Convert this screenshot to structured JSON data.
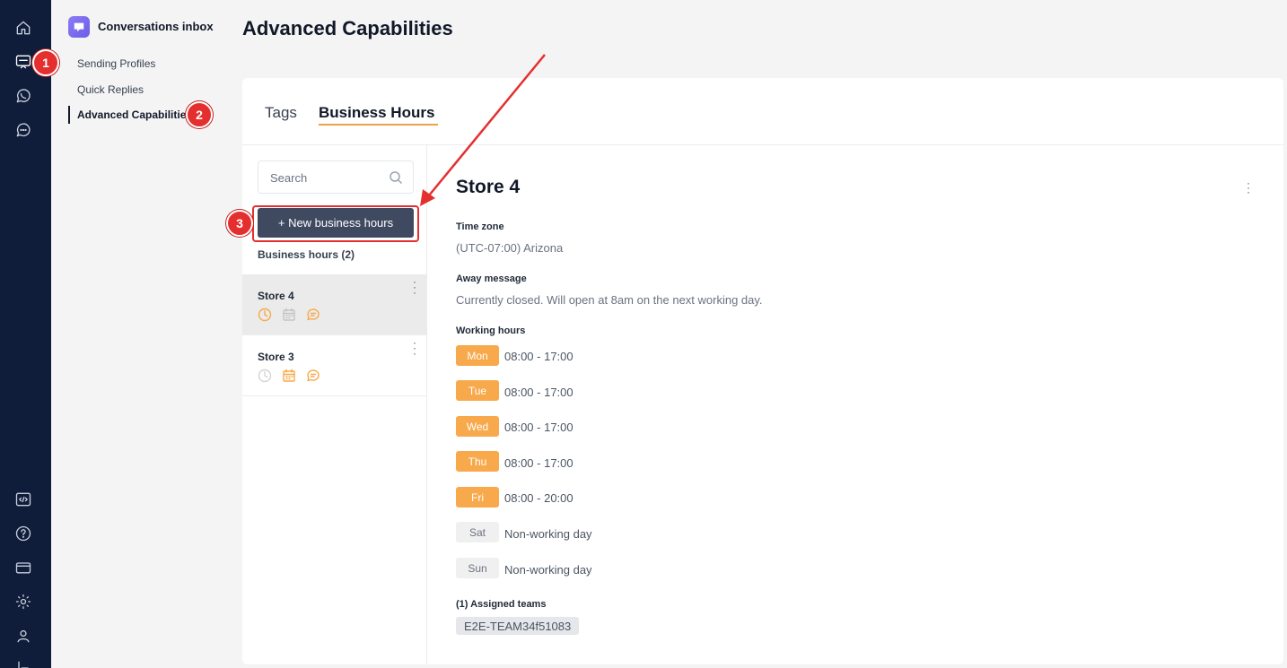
{
  "subnav": {
    "title": "Conversations inbox",
    "items": [
      {
        "label": "Sending Profiles"
      },
      {
        "label": "Quick Replies"
      },
      {
        "label": "Advanced Capabilities"
      }
    ]
  },
  "annotations": {
    "one": "1",
    "two": "2",
    "three": "3",
    "color": "#e52f2f"
  },
  "page": {
    "title": "Advanced Capabilities"
  },
  "tabs": [
    {
      "label": "Tags"
    },
    {
      "label": "Business Hours"
    }
  ],
  "list": {
    "search_placeholder": "Search",
    "new_button": "+ New business hours",
    "count_label": "Business hours (2)",
    "items": [
      {
        "name": "Store 4"
      },
      {
        "name": "Store 3"
      }
    ]
  },
  "detail": {
    "title": "Store 4",
    "timezone_label": "Time zone",
    "timezone_value": "(UTC-07:00) Arizona",
    "away_label": "Away message",
    "away_value": "Currently closed. Will open at 8am on the next working day.",
    "working_label": "Working hours",
    "days": [
      {
        "day": "Mon",
        "hours": "08:00 - 17:00"
      },
      {
        "day": "Tue",
        "hours": "08:00 - 17:00"
      },
      {
        "day": "Wed",
        "hours": "08:00 - 17:00"
      },
      {
        "day": "Thu",
        "hours": "08:00 - 17:00"
      },
      {
        "day": "Fri",
        "hours": "08:00 - 20:00"
      },
      {
        "day": "Sat",
        "hours": "Non-working day"
      },
      {
        "day": "Sun",
        "hours": "Non-working day"
      }
    ],
    "teams_label": "(1) Assigned teams",
    "teams": [
      {
        "name": "E2E-TEAM34f51083"
      }
    ]
  },
  "colors": {
    "accent": "#f7a94b",
    "rail": "#0f1d3a",
    "button": "#3f4a60"
  }
}
